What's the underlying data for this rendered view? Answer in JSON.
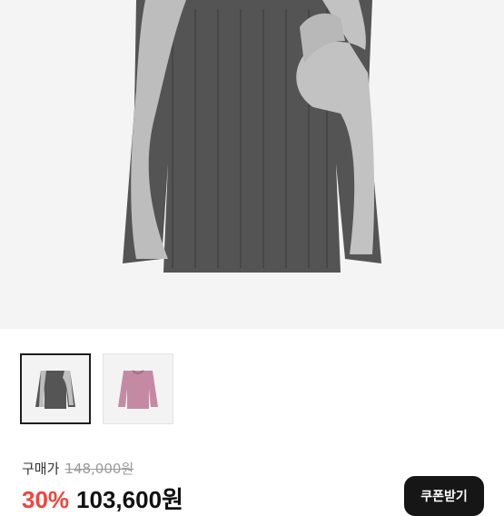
{
  "product": {
    "thumbnails": [
      {
        "name": "grey-sweater",
        "selected": true,
        "color": "#4a4a4a"
      },
      {
        "name": "pink-sweater",
        "selected": false,
        "color": "#c58aa3"
      }
    ]
  },
  "pricing": {
    "label": "구매가",
    "original_price": "148,000원",
    "discount": "30%",
    "final_price": "103,600원"
  },
  "coupon": {
    "label": "쿠폰받기"
  },
  "colors": {
    "accent_red": "#f2453c",
    "button_dark": "#161616"
  }
}
